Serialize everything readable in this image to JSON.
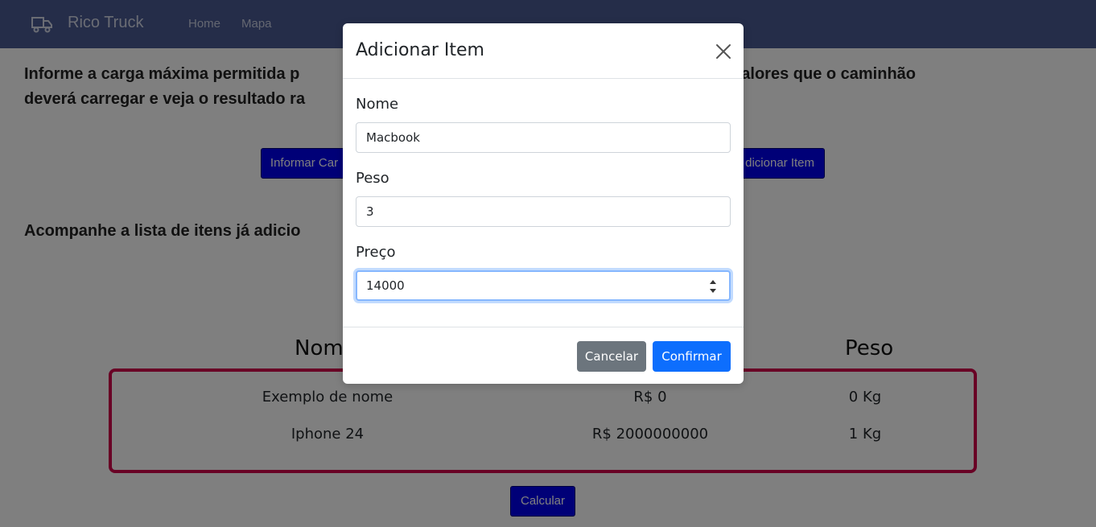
{
  "navbar": {
    "brand": "Rico Truck",
    "brand_icon": "truck-icon",
    "links": [
      "Home",
      "Mapa"
    ]
  },
  "main": {
    "intro_line1": "Informe a carga máxima permitida p",
    "intro_line1_end": "os itens e valores que o caminhão",
    "intro_line2": "deverá carregar e veja o resultado ra",
    "btn_informar": "Informar Car",
    "btn_adicionar": "dicionar Item",
    "list_heading": "Acompanhe a lista de itens já adicio",
    "columns": {
      "nome": "Nom",
      "peso": "Peso"
    },
    "rows": [
      {
        "nome": "Exemplo de nome",
        "preco": "R$ 0",
        "peso": "0 Kg"
      },
      {
        "nome": "Iphone 24",
        "preco": "R$ 2000000000",
        "peso": "1 Kg"
      }
    ],
    "btn_calcular": "Calcular"
  },
  "modal": {
    "title": "Adicionar Item",
    "fields": {
      "nome_label": "Nome",
      "nome_value": "Macbook",
      "peso_label": "Peso",
      "peso_value": "3",
      "preco_label": "Preço",
      "preco_value": "14000"
    },
    "cancel_label": "Cancelar",
    "confirm_label": "Confirmar"
  },
  "colors": {
    "navbar": "#4a5a92",
    "primary_button": "#0000ee",
    "table_border": "#d3054a",
    "confirm": "#0d6efd",
    "cancel": "#6c757d"
  }
}
